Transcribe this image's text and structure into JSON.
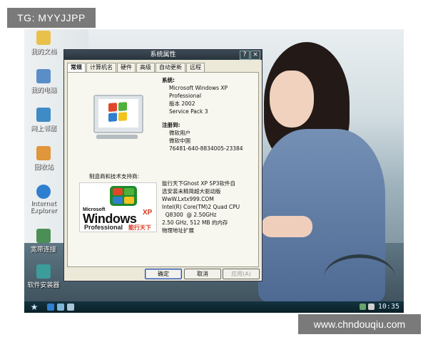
{
  "overlay": {
    "tag": "TG: MYYJJPP",
    "watermark": "www.chndouqiu.com"
  },
  "desktop": {
    "icons": [
      {
        "label": "我的文档",
        "icon": "documents-folder-icon",
        "color": "#e9c04a"
      },
      {
        "label": "我的电脑",
        "icon": "computer-icon",
        "color": "#5a8ec9"
      },
      {
        "label": "网上邻居",
        "icon": "network-icon",
        "color": "#3f8bc5"
      },
      {
        "label": "回收站",
        "icon": "recycle-bin-icon",
        "color": "#e0963a"
      },
      {
        "label": "Internet Explorer",
        "icon": "ie-icon",
        "color": "#2f7fd0"
      },
      {
        "label": "宽带连接",
        "icon": "broadband-icon",
        "color": "#4b8f57"
      },
      {
        "label": "软件安装器",
        "icon": "installer-icon",
        "color": "#3c9c9a"
      }
    ]
  },
  "dialog": {
    "title": "系统属性",
    "help_glyph": "?",
    "close_glyph": "×",
    "tabs": [
      "常规",
      "计算机名",
      "硬件",
      "高级",
      "自动更新",
      "远程"
    ],
    "active_tab": 0,
    "system": {
      "label": "系统:",
      "lines": [
        "Microsoft Windows XP",
        "Professional",
        "版本 2002",
        "Service Pack 3"
      ]
    },
    "registered": {
      "label": "注册到:",
      "lines": [
        "微软用户",
        "微软中国",
        "76481-640-8834005-23384"
      ]
    },
    "support_label": "制造商和技术支持商:",
    "oem": {
      "lines": [
        "能行天下Ghost XP SP3软件自",
        "选安装未精简超大驱动版",
        "WwW.Lxtx999.COM",
        "Intel(R) Core(TM)2 Quad CPU",
        "  Q8300  @ 2.50GHz",
        "2.50 GHz, 512 MB 的内存",
        "物理地址扩展"
      ]
    },
    "logo": {
      "brand": "Microsoft",
      "product": "Windows",
      "xp": "XP",
      "edition": "Professional",
      "tagline": "能行天下"
    },
    "buttons": {
      "ok": "确定",
      "cancel": "取消",
      "apply": "应用(A)"
    }
  },
  "taskbar": {
    "clock": "10:35",
    "start_glyph": "★"
  },
  "colors": {
    "dialog_bg": "#ece9d8",
    "titlebar": "#28343c",
    "xp_red": "#d8361b",
    "flag_red": "#e2462a",
    "flag_green": "#4fb03a",
    "flag_blue": "#2f7fd0",
    "flag_yellow": "#f2c21d"
  }
}
